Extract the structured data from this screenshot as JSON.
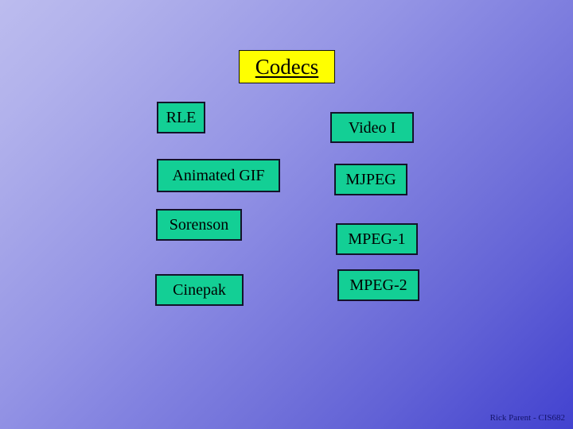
{
  "slide": {
    "title": "Codecs",
    "title_color": "#ffff00",
    "box_color": "#13cf95",
    "background_from": "#bcbcee",
    "background_to": "#4242d0",
    "footer": "Rick Parent - CIS682",
    "columns": [
      {
        "name": "left-column",
        "items": [
          {
            "label": "RLE"
          },
          {
            "label": "Animated GIF"
          },
          {
            "label": "Sorenson"
          },
          {
            "label": "Cinepak"
          }
        ]
      },
      {
        "name": "right-column",
        "items": [
          {
            "label": "Video I"
          },
          {
            "label": "MJPEG"
          },
          {
            "label": "MPEG-1"
          },
          {
            "label": "MPEG-2"
          }
        ]
      }
    ]
  }
}
